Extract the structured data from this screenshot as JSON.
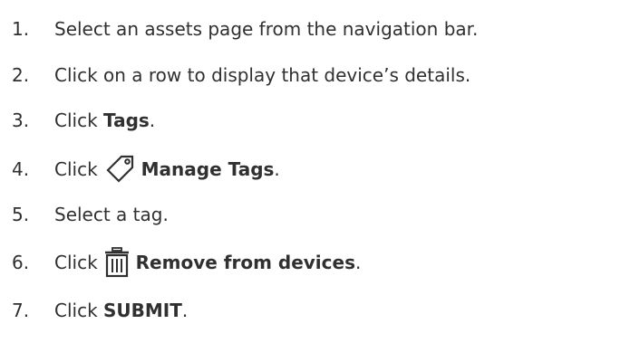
{
  "steps": [
    {
      "number": "1.",
      "text": "Select an assets page from the navigation bar."
    },
    {
      "number": "2.",
      "text": "Click on a row to display that device’s details."
    },
    {
      "number": "3.",
      "prefix": "Click ",
      "bold": "Tags",
      "suffix": "."
    },
    {
      "number": "4.",
      "prefix": "Click",
      "icon": "tag-icon",
      "bold": "Manage Tags",
      "suffix": "."
    },
    {
      "number": "5.",
      "text": "Select a tag."
    },
    {
      "number": "6.",
      "prefix": "Click",
      "icon": "trash-icon",
      "bold": "Remove from devices",
      "suffix": "."
    },
    {
      "number": "7.",
      "prefix": "Click ",
      "bold": "SUBMIT",
      "suffix": "."
    }
  ]
}
